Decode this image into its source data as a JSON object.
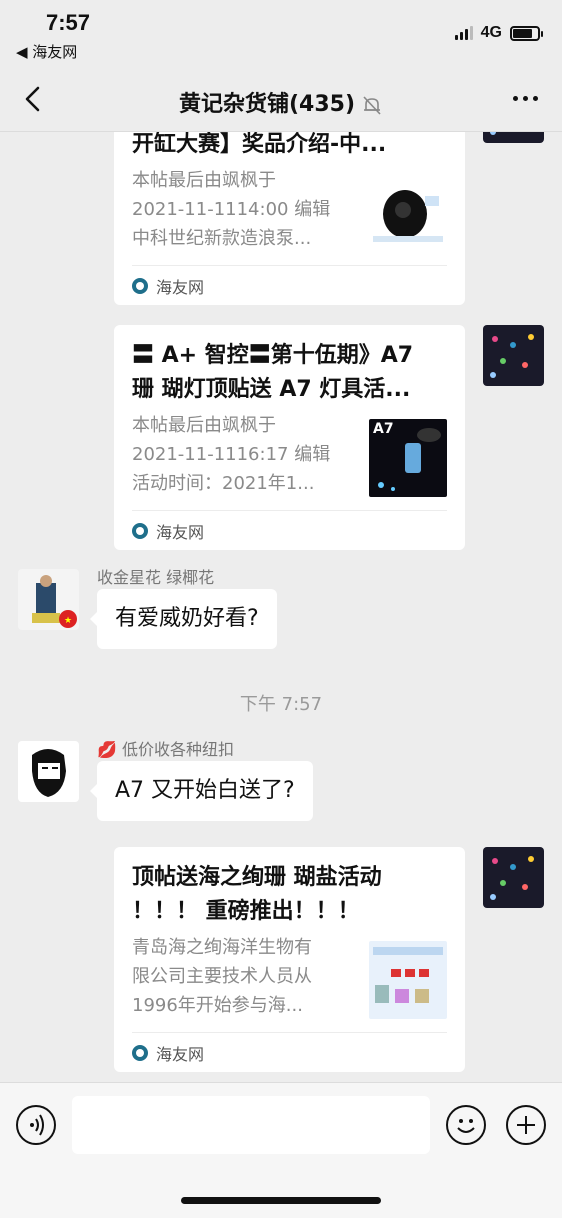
{
  "status_bar": {
    "time": "7:57",
    "back_app": "◀ 海友网",
    "network": "4G"
  },
  "nav": {
    "title": "黄记杂货铺(435)"
  },
  "messages": [
    {
      "type": "card",
      "title": "开缸大赛】奖品介绍-中...",
      "desc": "本帖最后由飒枫于\n2021-11-1114:00 编辑\n中科世纪新款造浪泵...",
      "source": "海友网"
    },
    {
      "type": "card",
      "title": "〓 A+ 智控〓第十伍期》A7\n珊 瑚灯顶贴送 A7 灯具活...",
      "desc": "本帖最后由飒枫于\n2021-11-1116:17 编辑\n活动时间：2021年1...",
      "thumb_label": "A7",
      "source": "海友网"
    },
    {
      "type": "text",
      "sender": "收金星花  绿椰花",
      "text": "有爱威奶好看?"
    },
    {
      "type": "time",
      "text": "下午 7:57"
    },
    {
      "type": "text",
      "sender": "💋 低价收各种纽扣",
      "text": "A7 又开始白送了?"
    },
    {
      "type": "card",
      "title": "顶帖送海之绚珊 瑚盐活动\n！！！ 重磅推出！！！",
      "desc": "青岛海之绚海洋生物有\n限公司主要技术人员从\n1996年开始参与海...",
      "source": "海友网"
    }
  ],
  "colors": {
    "background": "#ededed",
    "bubble": "#ffffff",
    "meta_text": "#8a8a8a"
  }
}
